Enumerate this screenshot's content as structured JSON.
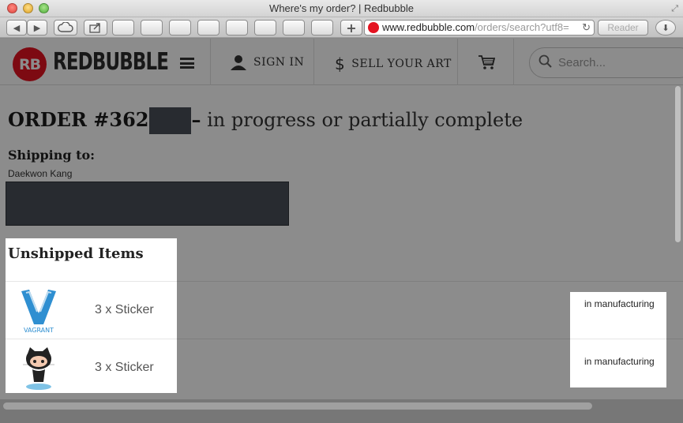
{
  "window": {
    "title": "Where's my order? | Redbubble",
    "resize_icon": "resize-icon"
  },
  "toolbar": {
    "back_icon": "◀",
    "forward_icon": "▶",
    "new_tab_label": "+",
    "url_host": "www.redbubble.com",
    "url_path": "/orders/search?utf8=",
    "reload_icon": "↻",
    "reader_label": "Reader",
    "download_icon": "⬇"
  },
  "header": {
    "logo_mark": "RB",
    "logo_text": "REDBUBBLE",
    "sign_in_label": "SIGN IN",
    "sell_label": "SELL YOUR ART",
    "search_placeholder": "Search..."
  },
  "order": {
    "number_prefix": "ORDER #362",
    "dash": "–",
    "status": " in progress or partially complete"
  },
  "shipping": {
    "label": "Shipping to:",
    "name": "Daekwon Kang"
  },
  "unshipped": {
    "title": "Unshipped Items",
    "items": [
      {
        "thumb": "vagrant-logo",
        "thumb_text": "VAGRANT",
        "qty_label": "3 x Sticker",
        "status": "in manufacturing"
      },
      {
        "thumb": "github-octocat",
        "thumb_text": "",
        "qty_label": "3 x Sticker",
        "status": "in manufacturing"
      }
    ]
  },
  "colors": {
    "brand_red": "#e41321",
    "redaction": "#4a4f58"
  }
}
